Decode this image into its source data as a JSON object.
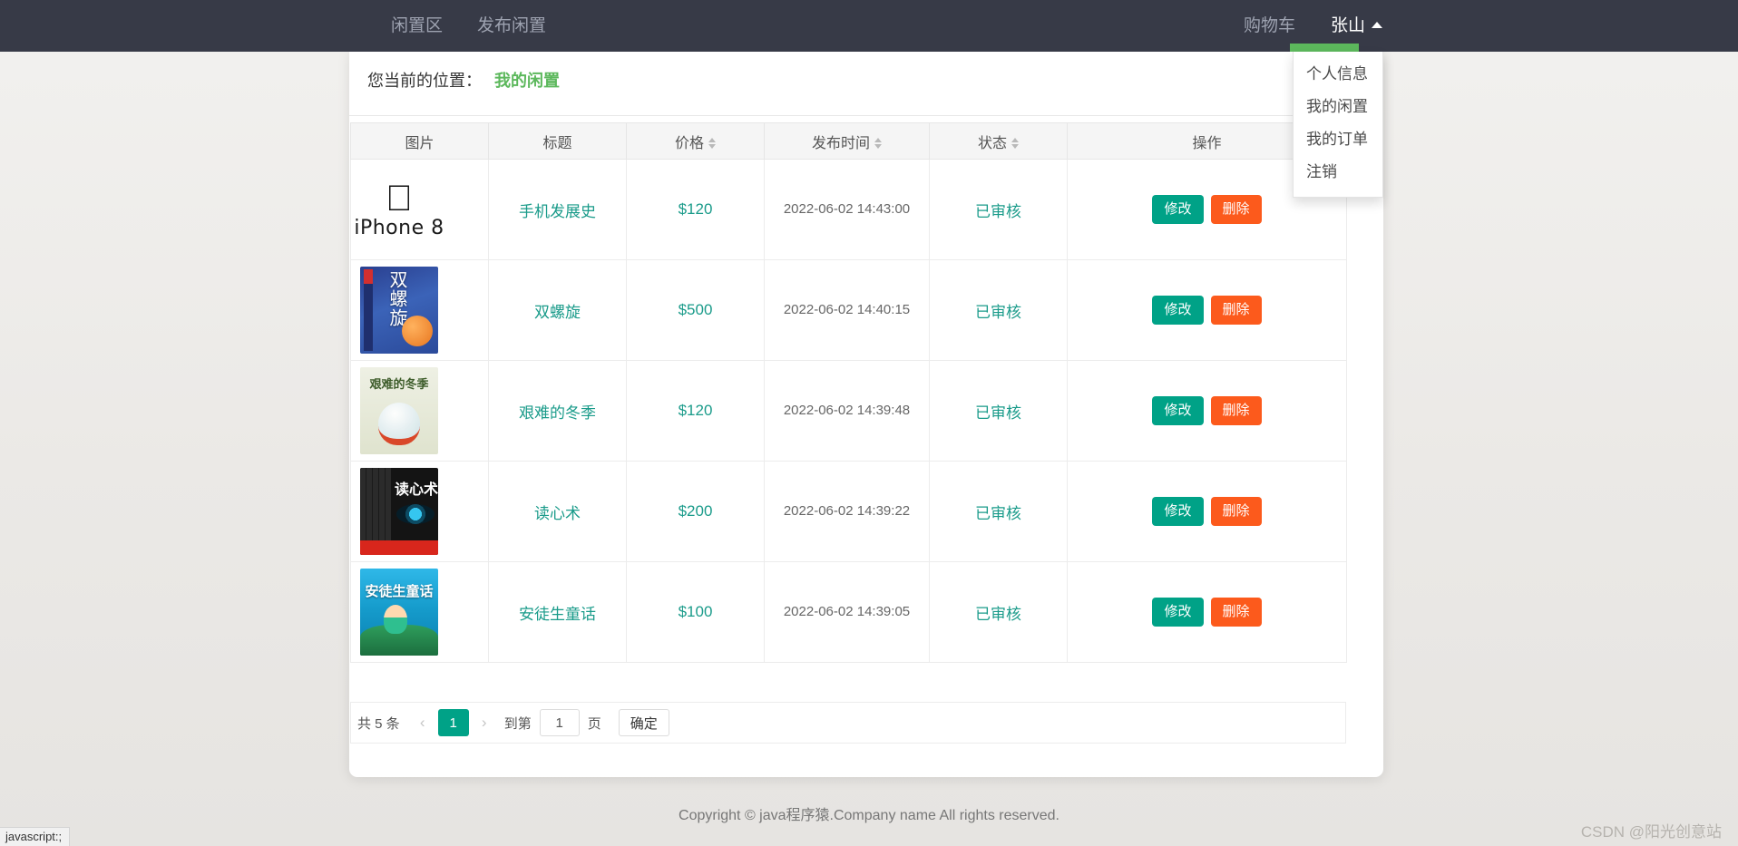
{
  "navbar": {
    "brand_links": [
      {
        "label": "闲置区"
      },
      {
        "label": "发布闲置"
      }
    ],
    "cart_label": "购物车",
    "user_name": "张山",
    "caret_icon": "caret-up-icon",
    "underline_color": "#5cb85c",
    "background_color": "#373a47"
  },
  "dropdown": {
    "items": [
      {
        "label": "个人信息"
      },
      {
        "label": "我的闲置"
      },
      {
        "label": "我的订单"
      },
      {
        "label": "注销"
      }
    ]
  },
  "breadcrumb": {
    "prefix": "您当前的位置：",
    "current": "我的闲置",
    "current_color": "#5cb85c"
  },
  "table": {
    "headers": [
      {
        "label": "图片",
        "sortable": false
      },
      {
        "label": "标题",
        "sortable": false
      },
      {
        "label": "价格",
        "sortable": true
      },
      {
        "label": "发布时间",
        "sortable": true
      },
      {
        "label": "状态",
        "sortable": true
      },
      {
        "label": "操作",
        "sortable": false
      }
    ],
    "rows": [
      {
        "image_name": "iphone-8-product-image",
        "image_kind": "iphone",
        "image_text": "iPhone 8",
        "title": "手机发展史",
        "price": "$120",
        "currency": "$",
        "price_value": "120",
        "time": "2022-06-02 14:43:00",
        "status": "已审核",
        "edit_label": "修改",
        "delete_label": "删除"
      },
      {
        "image_name": "double-helix-book-cover",
        "image_kind": "helix",
        "image_text": "双螺旋",
        "title": "双螺旋",
        "price": "$500",
        "currency": "$",
        "price_value": "500",
        "time": "2022-06-02 14:40:15",
        "status": "已审核",
        "edit_label": "修改",
        "delete_label": "删除"
      },
      {
        "image_name": "hard-winter-book-cover",
        "image_kind": "winter",
        "image_text": "艰难的冬季",
        "title": "艰难的冬季",
        "price": "$120",
        "currency": "$",
        "price_value": "120",
        "time": "2022-06-02 14:39:48",
        "status": "已审核",
        "edit_label": "修改",
        "delete_label": "删除"
      },
      {
        "image_name": "mind-reading-book-cover",
        "image_kind": "mind",
        "image_text": "读心术",
        "title": "读心术",
        "price": "$200",
        "currency": "$",
        "price_value": "200",
        "time": "2022-06-02 14:39:22",
        "status": "已审核",
        "edit_label": "修改",
        "delete_label": "删除"
      },
      {
        "image_name": "andersen-fairy-tales-book-cover",
        "image_kind": "ander",
        "image_text": "安徒生童话",
        "title": "安徒生童话",
        "price": "$100",
        "currency": "$",
        "price_value": "100",
        "time": "2022-06-02 14:39:05",
        "status": "已审核",
        "edit_label": "修改",
        "delete_label": "删除"
      }
    ]
  },
  "pagination": {
    "total_text": "共 5 条",
    "prev_icon": "chevron-left-icon",
    "next_icon": "chevron-right-icon",
    "current_page": "1",
    "goto_label": "到第",
    "page_input_value": "1",
    "page_unit": "页",
    "confirm_label": "确定",
    "active_color": "#00a287"
  },
  "footer": {
    "copyright": "Copyright © java程序猿.Company name All rights reserved."
  },
  "watermark": {
    "text": "CSDN @阳光创意站"
  },
  "statusbar": {
    "text": "javascript:;"
  }
}
